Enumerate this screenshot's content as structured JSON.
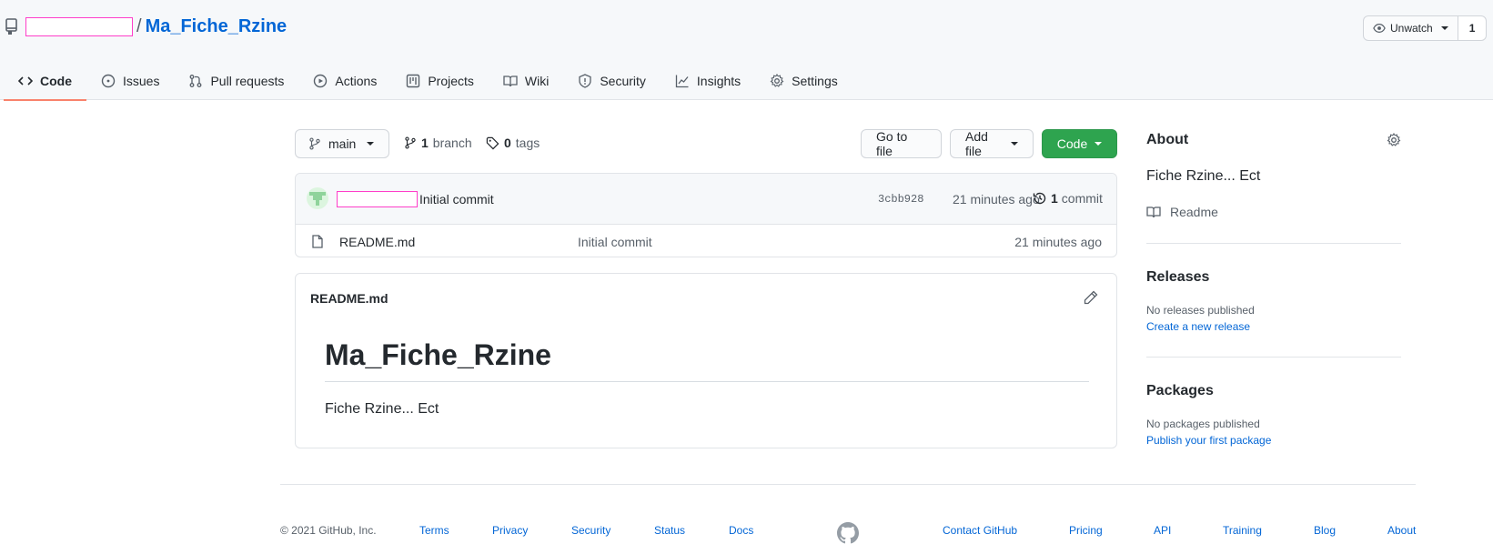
{
  "header": {
    "repo_name": "Ma_Fiche_Rzine",
    "separator": "/",
    "watch_label": "Unwatch",
    "watch_count": "1"
  },
  "tabs": [
    {
      "label": "Code",
      "icon": "code-icon",
      "active": true
    },
    {
      "label": "Issues",
      "icon": "issue-icon"
    },
    {
      "label": "Pull requests",
      "icon": "pull-request-icon"
    },
    {
      "label": "Actions",
      "icon": "play-icon"
    },
    {
      "label": "Projects",
      "icon": "project-icon"
    },
    {
      "label": "Wiki",
      "icon": "book-icon"
    },
    {
      "label": "Security",
      "icon": "shield-icon"
    },
    {
      "label": "Insights",
      "icon": "graph-icon"
    },
    {
      "label": "Settings",
      "icon": "gear-icon"
    }
  ],
  "toolbar": {
    "branch": "main",
    "branch_count": "1",
    "branch_label": "branch",
    "tag_count": "0",
    "tag_label": "tags",
    "go_to_file": "Go to file",
    "add_file": "Add file",
    "code": "Code"
  },
  "commit": {
    "message": "Initial commit",
    "sha": "3cbb928",
    "age": "21 minutes ago",
    "count": "1",
    "count_label": "commit"
  },
  "files": [
    {
      "name": "README.md",
      "message": "Initial commit",
      "age": "21 minutes ago"
    }
  ],
  "readme": {
    "label": "README.md",
    "heading": "Ma_Fiche_Rzine",
    "body": "Fiche Rzine... Ect"
  },
  "sidebar": {
    "about_title": "About",
    "about_text": "Fiche Rzine... Ect",
    "readme_link": "Readme",
    "releases_title": "Releases",
    "releases_none": "No releases published",
    "releases_link": "Create a new release",
    "packages_title": "Packages",
    "packages_none": "No packages published",
    "packages_link": "Publish your first package"
  },
  "footer": {
    "copyright": "© 2021 GitHub, Inc.",
    "left_links": [
      "Terms",
      "Privacy",
      "Security",
      "Status",
      "Docs"
    ],
    "right_links": [
      "Contact GitHub",
      "Pricing",
      "API",
      "Training",
      "Blog",
      "About"
    ]
  },
  "colors": {
    "accent": "#0366d6",
    "primary_button": "#2ea44f",
    "active_tab_underline": "#f9826c",
    "redaction_border": "#ff3ec9"
  }
}
